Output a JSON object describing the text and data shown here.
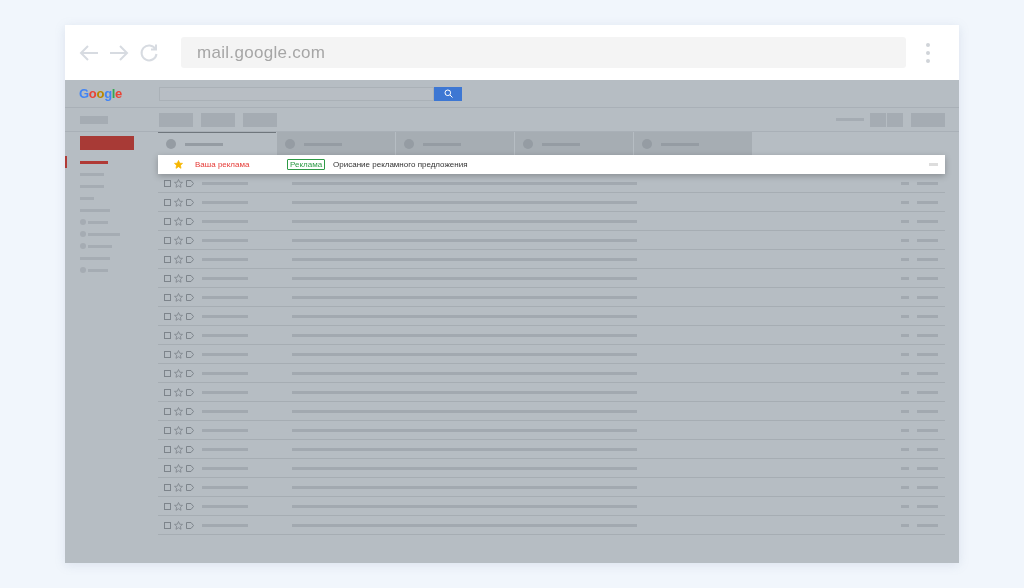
{
  "browser": {
    "address": "mail.google.com"
  },
  "logo": "Google",
  "tabs": [
    {
      "selected": true
    },
    {
      "selected": false
    },
    {
      "selected": false
    },
    {
      "selected": false
    },
    {
      "selected": false
    }
  ],
  "sidebar": {
    "items": [
      {
        "kind": "line",
        "selected": true
      },
      {
        "kind": "line",
        "selected": false
      },
      {
        "kind": "line",
        "selected": false
      },
      {
        "kind": "line",
        "selected": false
      },
      {
        "kind": "line",
        "selected": false
      },
      {
        "kind": "dot",
        "selected": false
      },
      {
        "kind": "dot",
        "selected": false
      },
      {
        "kind": "dot",
        "selected": false
      },
      {
        "kind": "line",
        "selected": false
      },
      {
        "kind": "dot",
        "selected": false
      }
    ]
  },
  "ad_row": {
    "starred": true,
    "sender": "Ваша реклама",
    "tag": "Реклама",
    "subject": "Орисание рекламного предложения"
  },
  "rows": [
    {
      "starred": false
    },
    {
      "starred": false
    },
    {
      "starred": false
    },
    {
      "starred": false
    },
    {
      "starred": false
    },
    {
      "starred": false
    },
    {
      "starred": false
    },
    {
      "starred": false
    },
    {
      "starred": false
    },
    {
      "starred": false
    },
    {
      "starred": false
    },
    {
      "starred": false
    },
    {
      "starred": false
    },
    {
      "starred": false
    },
    {
      "starred": false
    },
    {
      "starred": false
    },
    {
      "starred": false
    },
    {
      "starred": false
    },
    {
      "starred": false
    }
  ]
}
